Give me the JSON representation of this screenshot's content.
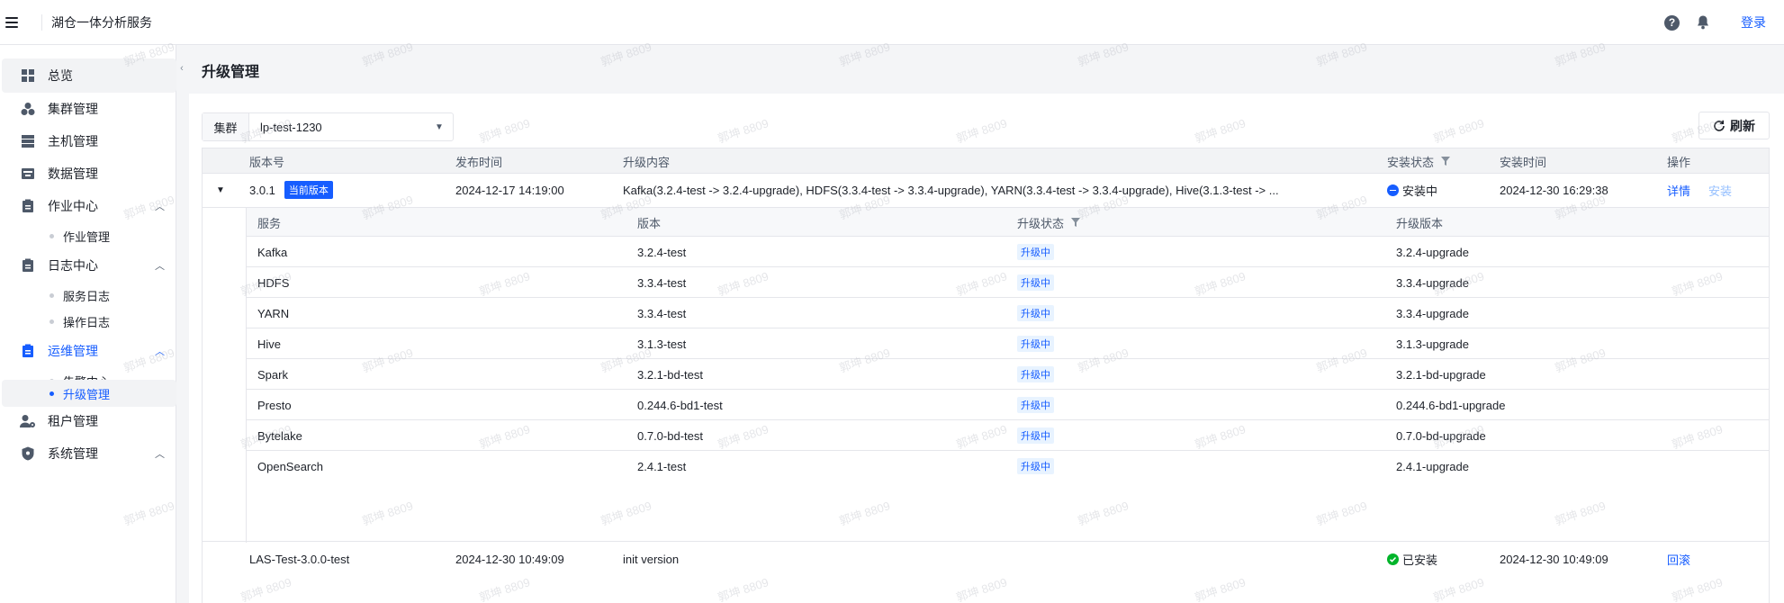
{
  "header": {
    "app_title": "湖仓一体分析服务",
    "login": "登录"
  },
  "sidebar": {
    "items": [
      {
        "label": "总览",
        "icon": "dashboard-icon"
      },
      {
        "label": "集群管理",
        "icon": "cluster-icon"
      },
      {
        "label": "主机管理",
        "icon": "server-icon"
      },
      {
        "label": "数据管理",
        "icon": "data-icon"
      },
      {
        "label": "作业中心",
        "icon": "clipboard-icon"
      },
      {
        "label": "作业管理"
      },
      {
        "label": "日志中心",
        "icon": "clipboard-icon"
      },
      {
        "label": "服务日志"
      },
      {
        "label": "操作日志"
      },
      {
        "label": "运维管理",
        "icon": "clipboard-icon"
      },
      {
        "label": "告警中心"
      },
      {
        "label": "升级管理"
      },
      {
        "label": "租户管理",
        "icon": "user-gear-icon"
      },
      {
        "label": "系统管理",
        "icon": "shield-icon"
      }
    ]
  },
  "page": {
    "title": "升级管理",
    "cluster_label": "集群",
    "cluster_value": "lp-test-1230",
    "refresh": "刷新"
  },
  "table": {
    "columns": [
      "版本号",
      "发布时间",
      "升级内容",
      "安装状态",
      "安装时间",
      "操作"
    ],
    "rows": [
      {
        "version": "3.0.1",
        "tag": "当前版本",
        "release_time": "2024-12-17 14:19:00",
        "content": "Kafka(3.2.4-test -> 3.2.4-upgrade), HDFS(3.3.4-test -> 3.3.4-upgrade), YARN(3.3.4-test -> 3.3.4-upgrade), Hive(3.1.3-test -> ...",
        "status": "安装中",
        "install_time": "2024-12-30 16:29:38",
        "action1": "详情",
        "action2": "安装"
      },
      {
        "version": "LAS-Test-3.0.0-test",
        "release_time": "2024-12-30 10:49:09",
        "content": "init version",
        "status": "已安装",
        "install_time": "2024-12-30 10:49:09",
        "action1": "回滚"
      }
    ],
    "sub_columns": [
      "服务",
      "版本",
      "升级状态",
      "升级版本"
    ],
    "sub_rows": [
      {
        "service": "Kafka",
        "version": "3.2.4-test",
        "status": "升级中",
        "target": "3.2.4-upgrade"
      },
      {
        "service": "HDFS",
        "version": "3.3.4-test",
        "status": "升级中",
        "target": "3.3.4-upgrade"
      },
      {
        "service": "YARN",
        "version": "3.3.4-test",
        "status": "升级中",
        "target": "3.3.4-upgrade"
      },
      {
        "service": "Hive",
        "version": "3.1.3-test",
        "status": "升级中",
        "target": "3.1.3-upgrade"
      },
      {
        "service": "Spark",
        "version": "3.2.1-bd-test",
        "status": "升级中",
        "target": "3.2.1-bd-upgrade"
      },
      {
        "service": "Presto",
        "version": "0.244.6-bd1-test",
        "status": "升级中",
        "target": "0.244.6-bd1-upgrade"
      },
      {
        "service": "Bytelake",
        "version": "0.7.0-bd-test",
        "status": "升级中",
        "target": "0.7.0-bd-upgrade"
      },
      {
        "service": "OpenSearch",
        "version": "2.4.1-test",
        "status": "升级中",
        "target": "2.4.1-upgrade"
      }
    ]
  },
  "watermark": "郭坤 8809",
  "colors": {
    "accent": "#165dff",
    "success": "#00b42a"
  }
}
